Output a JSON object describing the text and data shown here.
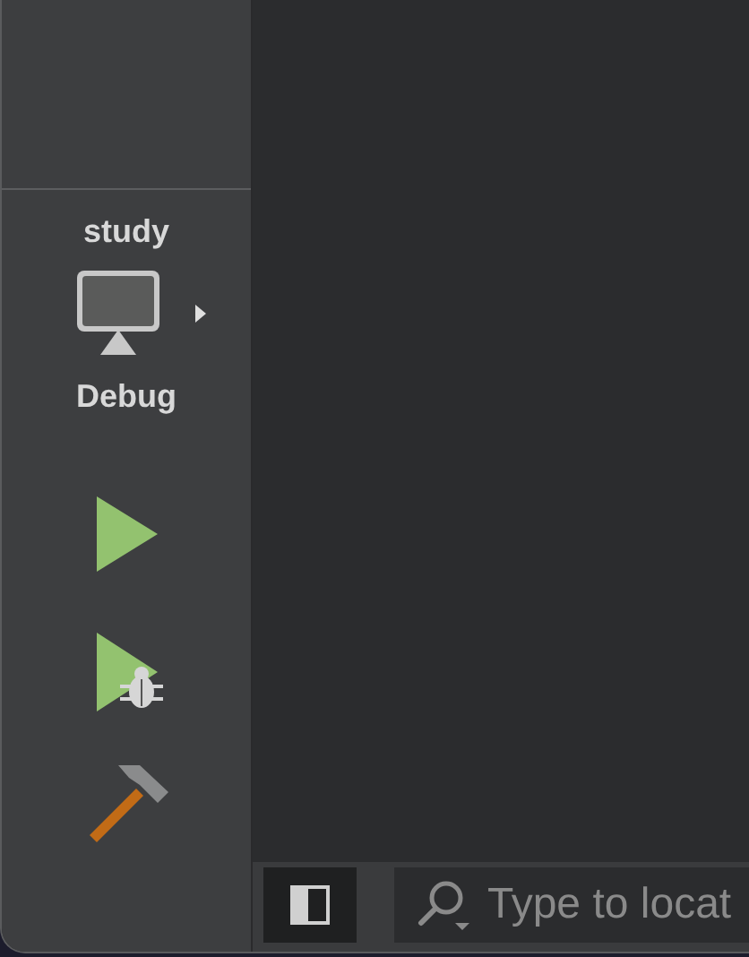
{
  "sidebar": {
    "scheme": "study",
    "destination": "Debug"
  },
  "locate_field": {
    "placeholder": "Type to locat"
  }
}
